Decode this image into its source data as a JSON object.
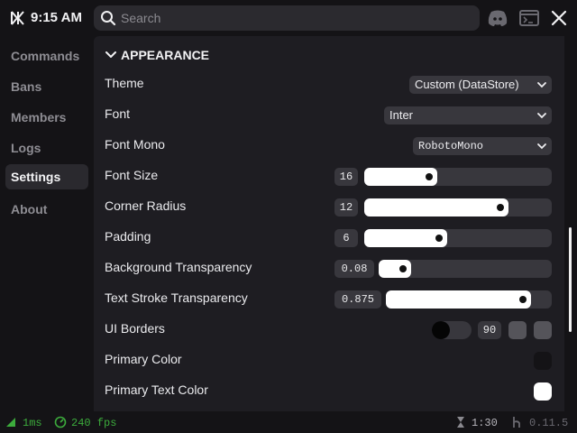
{
  "header": {
    "time": "9:15 AM",
    "search_placeholder": "Search",
    "icons": [
      "logo-icon",
      "search-icon",
      "discord-icon",
      "terminal-icon",
      "close-icon"
    ]
  },
  "sidebar": {
    "items": [
      {
        "label": "Commands",
        "active": false
      },
      {
        "label": "Bans",
        "active": false
      },
      {
        "label": "Members",
        "active": false
      },
      {
        "label": "Logs",
        "active": false
      },
      {
        "label": "Settings",
        "active": true
      },
      {
        "label": "About",
        "active": false
      }
    ]
  },
  "settings": {
    "section": "APPEARANCE",
    "theme": {
      "label": "Theme",
      "value": "Custom (DataStore)"
    },
    "font": {
      "label": "Font",
      "value": "Inter"
    },
    "font_mono": {
      "label": "Font Mono",
      "value": "RobotoMono"
    },
    "font_size": {
      "label": "Font Size",
      "value": "16",
      "fraction": 0.39
    },
    "corner_radius": {
      "label": "Corner Radius",
      "value": "12",
      "fraction": 0.77
    },
    "padding": {
      "label": "Padding",
      "value": "6",
      "fraction": 0.44
    },
    "background_transparency": {
      "label": "Background Transparency",
      "value": "0.08",
      "fraction": 0.08
    },
    "text_stroke_transparency": {
      "label": "Text Stroke Transparency",
      "value": "0.875",
      "fraction": 0.875
    },
    "ui_borders": {
      "label": "UI Borders",
      "enabled": false,
      "value": "90"
    },
    "primary_color": {
      "label": "Primary Color",
      "color": "#141316"
    },
    "primary_text_color": {
      "label": "Primary Text Color",
      "color": "#ffffff"
    }
  },
  "status": {
    "ping": "1ms",
    "fps": "240 fps",
    "timer": "1:30",
    "version": "0.11.5",
    "colors": {
      "good": "#3cab3c",
      "muted": "#8a898f"
    }
  },
  "colors": {
    "background": "#141316",
    "panel": "#1e1d22",
    "control": "#38373d",
    "accent": "#ffffff"
  }
}
